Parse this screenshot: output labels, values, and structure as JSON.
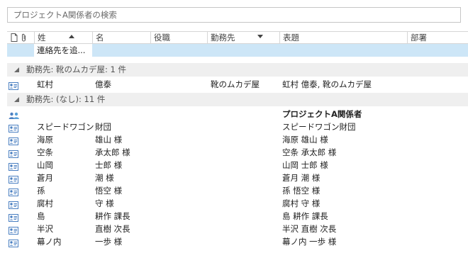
{
  "search": {
    "placeholder": "プロジェクトA関係者の検索"
  },
  "columns": {
    "surname": "姓",
    "given": "名",
    "role": "役職",
    "company": "勤務先",
    "title": "表題",
    "department": "部署"
  },
  "new_row": {
    "label": "連絡先を追..."
  },
  "groups": [
    {
      "label": "勤務先: 靴のムカデ屋: 1 件"
    },
    {
      "label": "勤務先: (なし): 11 件"
    }
  ],
  "group1_rows": [
    {
      "icon": "contact-card-icon",
      "surname": "虹村",
      "given": "億泰",
      "company": "靴のムカデ屋",
      "title": "虹村 億泰, 靴のムカデ屋"
    }
  ],
  "group2_rows": [
    {
      "icon": "contact-group-icon",
      "surname": "",
      "given": "",
      "company": "",
      "title": "プロジェクトA関係者"
    },
    {
      "icon": "contact-card-icon",
      "surname": "スピードワゴン",
      "given": "財団",
      "company": "",
      "title": "スピードワゴン財団"
    },
    {
      "icon": "contact-card-icon",
      "surname": "海原",
      "given": "雄山 様",
      "company": "",
      "title": "海原 雄山 様"
    },
    {
      "icon": "contact-card-icon",
      "surname": "空条",
      "given": "承太郎 様",
      "company": "",
      "title": "空条 承太郎 様"
    },
    {
      "icon": "contact-card-icon",
      "surname": "山岡",
      "given": "士郎 様",
      "company": "",
      "title": "山岡 士郎 様"
    },
    {
      "icon": "contact-card-icon",
      "surname": "蒼月",
      "given": "潮 様",
      "company": "",
      "title": "蒼月 潮 様"
    },
    {
      "icon": "contact-card-icon",
      "surname": "孫",
      "given": "悟空 様",
      "company": "",
      "title": "孫 悟空 様"
    },
    {
      "icon": "contact-card-icon",
      "surname": "腐村",
      "given": "守 様",
      "company": "",
      "title": "腐村 守 様"
    },
    {
      "icon": "contact-card-icon",
      "surname": "島",
      "given": "耕作 課長",
      "company": "",
      "title": "島 耕作 課長"
    },
    {
      "icon": "contact-card-icon",
      "surname": "半沢",
      "given": "直樹 次長",
      "company": "",
      "title": "半沢 直樹 次長"
    },
    {
      "icon": "contact-card-icon",
      "surname": "幕ノ内",
      "given": "一歩 様",
      "company": "",
      "title": "幕ノ内 一歩 様"
    }
  ],
  "colors": {
    "selection": "#cde6f7",
    "group_bg": "#efefef",
    "icon_blue": "#4a7fc1"
  }
}
